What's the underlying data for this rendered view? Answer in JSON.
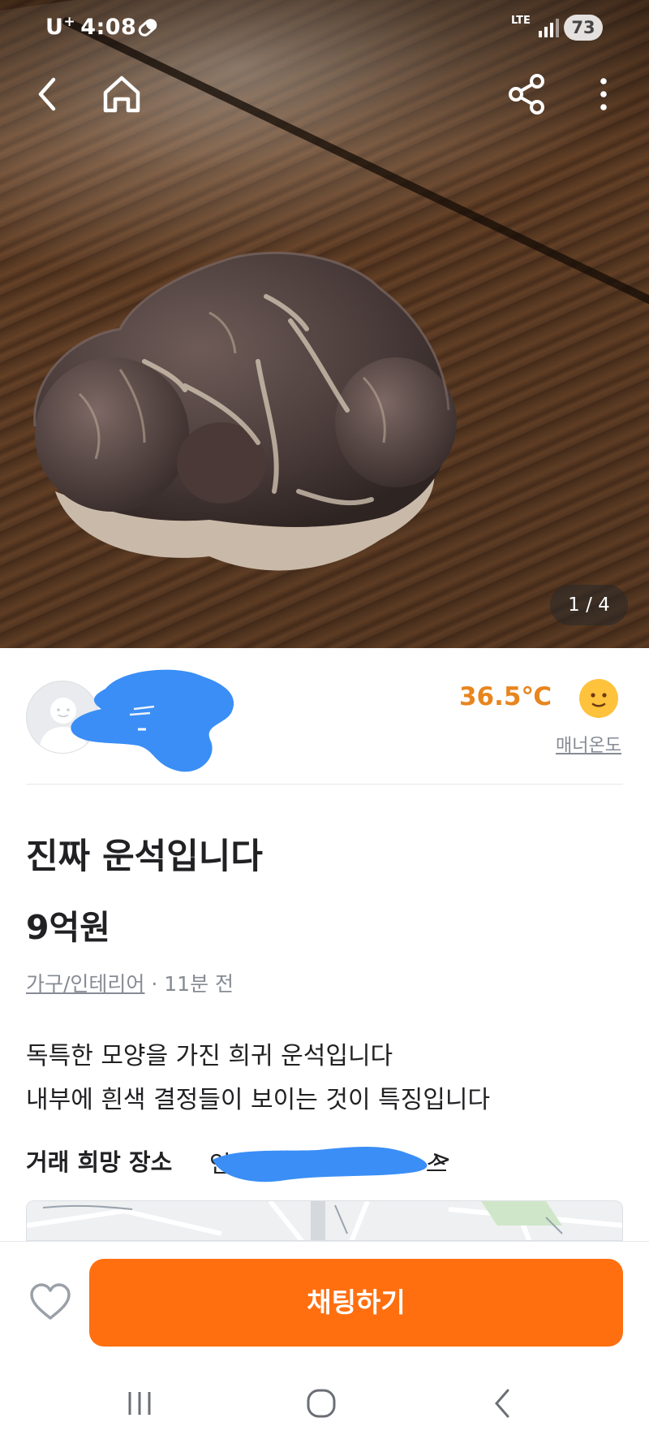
{
  "status_bar": {
    "carrier": "U",
    "carrier_plus": "+",
    "time": "4:08",
    "network": "LTE",
    "battery": "73"
  },
  "photo": {
    "counter": "1 / 4"
  },
  "seller": {
    "temperature": "36.5℃",
    "manner_label": "매너온도"
  },
  "listing": {
    "title": "진짜 운석입니다",
    "price": "9억원",
    "category": "가구/인테리어",
    "time_ago": " · 11분 전",
    "description_line1": "독특한 모양을 가진 희귀 운석입니다",
    "description_line2": "내부에 흰색 결정들이 보이는 것이 특징입니다",
    "location_label": "거래 희망 장소",
    "location_value_start": "인",
    "location_value_end": "스",
    "location_chevron": ">"
  },
  "actions": {
    "chat_button": "채팅하기"
  },
  "icons": {
    "back": "back-arrow-icon",
    "home": "home-icon",
    "share": "share-icon",
    "more": "more-vertical-icon",
    "like": "heart-icon",
    "temperature_face": "smile-face-icon"
  },
  "colors": {
    "accent": "#ff6f0f",
    "temperature": "#e8851e",
    "muted_text": "#868b94",
    "redaction": "#3a8ef6"
  }
}
